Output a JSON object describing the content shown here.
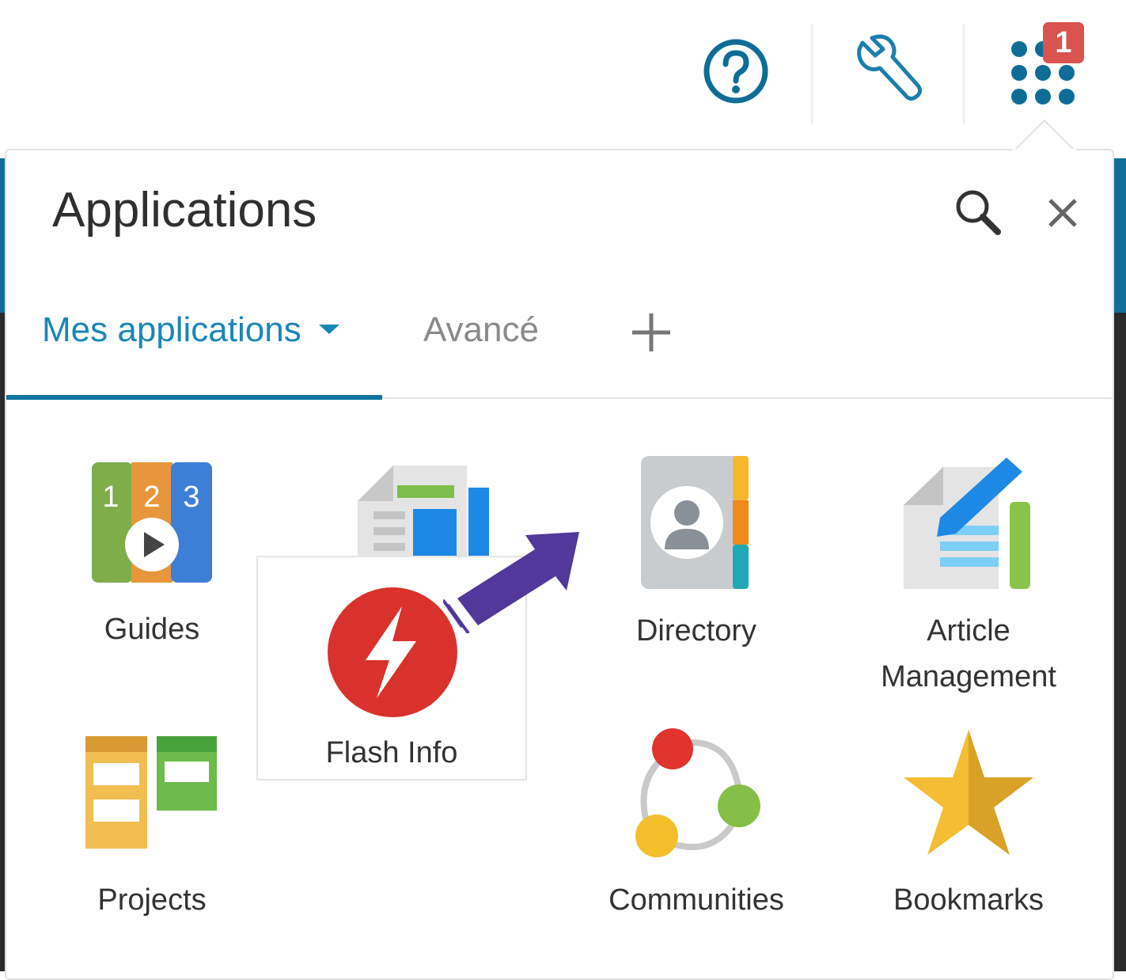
{
  "toolbar": {
    "help_icon": "help-circle-icon",
    "settings_icon": "wrench-icon",
    "apps_icon": "apps-grid-icon",
    "notification_count": "1"
  },
  "panel": {
    "title": "Applications",
    "search_icon": "search-icon",
    "close_icon": "close-icon"
  },
  "tabs": {
    "active_label": "Mes applications",
    "second_label": "Avancé",
    "add_icon": "plus-icon"
  },
  "apps": [
    {
      "label": "Guides",
      "icon": "guides-icon"
    },
    {
      "label": "",
      "icon": "news-icon"
    },
    {
      "label": "Directory",
      "icon": "directory-icon"
    },
    {
      "label": "Article",
      "label2": "Management",
      "icon": "article-management-icon"
    },
    {
      "label": "Projects",
      "icon": "projects-icon"
    },
    {
      "label": "Communities",
      "icon": "communities-icon"
    },
    {
      "label": "Bookmarks",
      "icon": "bookmarks-icon"
    }
  ],
  "dragged_app": {
    "label": "Flash Info",
    "icon": "flash-info-icon"
  },
  "colors": {
    "accent": "#1a86b5",
    "badge": "#d9534f",
    "arrow": "#51389a",
    "flash_red": "#d9322c"
  }
}
